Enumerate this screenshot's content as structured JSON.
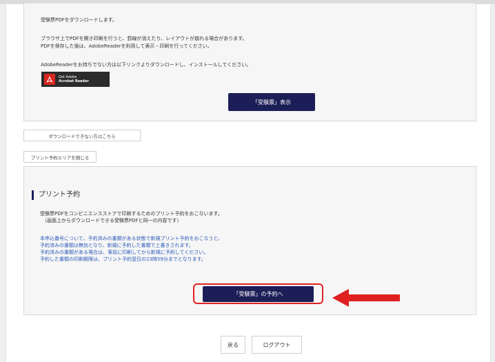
{
  "download_section": {
    "line1": "受験票PDFをダウンロードします。",
    "line2": "ブラウザ上でPDFを開き印刷を行うと、罫線が消えたり、レイアウトが崩れる場合があります。",
    "line3": "PDFを保存した後は、AdobeReaderを利用して表示・印刷を行ってください。",
    "line4": "AdobeReaderをお持ちでない方は以下リンクよりダウンロードし、インストールしてください。",
    "adobe_badge": {
      "line1": "Get Adobe",
      "line2": "Acrobat Reader"
    },
    "view_button": "「受験票」表示"
  },
  "download_help_button": "ダウンロードできない方はこちら",
  "hide_print_area_button": "プリント予約エリアを閉じる",
  "print_section": {
    "title": "プリント予約",
    "desc1": "受験票PDFをコンビニエンスストアで印刷するためのプリント予約をおこないます。",
    "desc2": "（画面上からダウンロードできる受験票PDFと同一の内容です）",
    "notes": [
      "本申込番号について、予約済みの書類がある状態で新規プリント予約をおこなうと、",
      "予約済みの書類は無効となり、新規に予約した書類で上書きされます。",
      "予約済みの書類がある場合は、事前に印刷してから新規に予約してください。",
      "予約した書類の印刷期限は、プリント予約翌日の23時59分までとなります。"
    ],
    "reserve_button": "「受験票」の予約へ"
  },
  "footer": {
    "back_button": "戻る",
    "logout_button": "ログアウト"
  },
  "colors": {
    "primary_button": "#1c1e57",
    "note_text": "#2a5ab8",
    "highlight": "#e02020"
  }
}
